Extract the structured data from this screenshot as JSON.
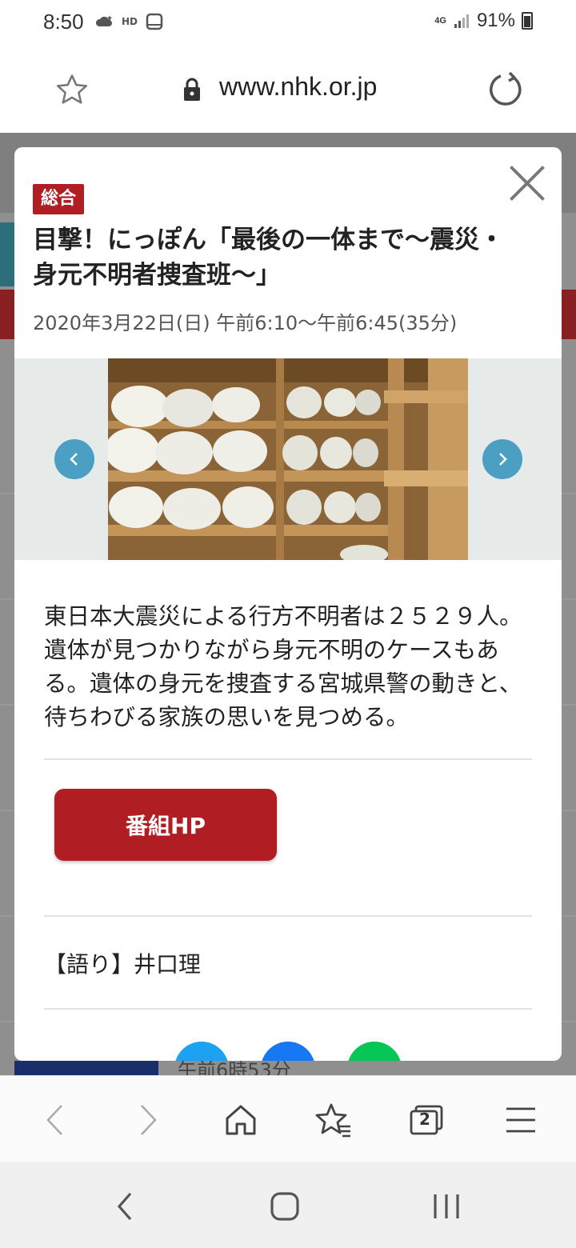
{
  "status_bar": {
    "time": "8:50",
    "network": "4G",
    "battery": "91%"
  },
  "browser": {
    "url": "www.nhk.or.jp",
    "tab_count": "2"
  },
  "background_page": {
    "partial_time_text": "午前6時53分"
  },
  "program": {
    "channel": "総合",
    "title": "目撃！にっぽん「最後の一体まで〜震災・身元不明者捜査班〜」",
    "air_time": "2020年3月22日(日) 午前6:10〜午前6:45(35分)",
    "description": "東日本大震災による行方不明者は２５２９人。遺体が見つかりながら身元不明のケースもある。遺体の身元を捜査する宮城県警の動きと、待ちわびる家族の思いを見つめる。",
    "hp_button_label": "番組HP",
    "narrator": "【語り】井口理"
  },
  "colors": {
    "accent_red": "#b01e23",
    "carousel_arrow": "#4a9fc3",
    "twitter": "#1da1f2",
    "facebook": "#1877f2",
    "line": "#06c755"
  },
  "icons": {
    "close": "close-icon",
    "prev": "chevron-left-icon",
    "next": "chevron-right-icon",
    "star": "star-icon",
    "lock": "lock-icon",
    "reload": "reload-icon"
  }
}
